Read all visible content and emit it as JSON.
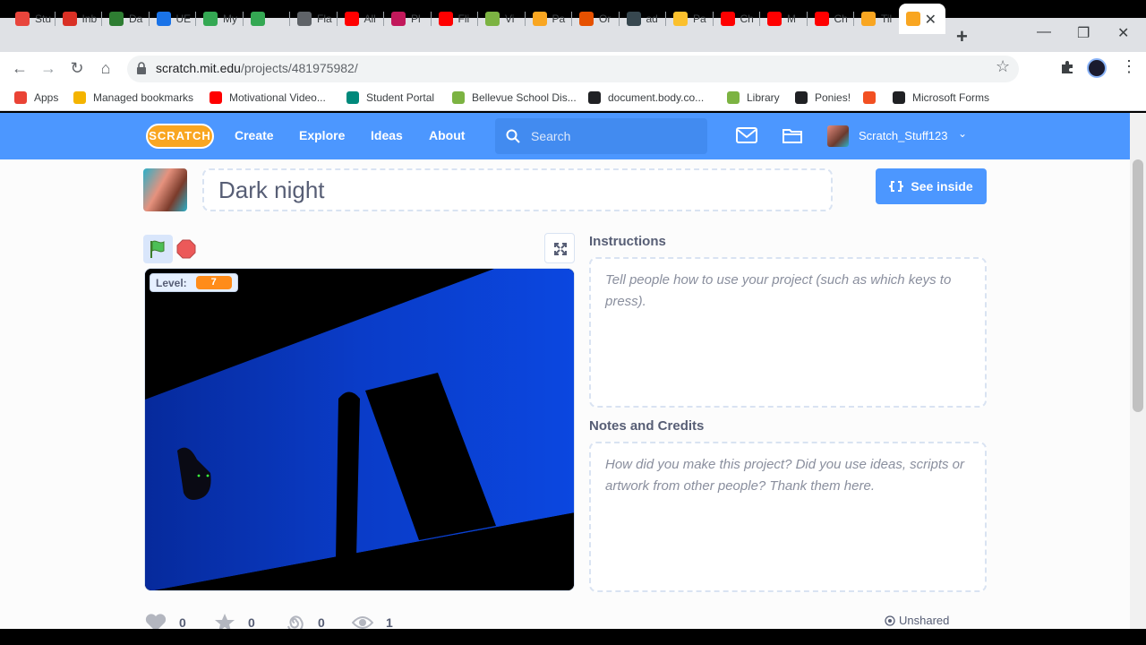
{
  "browser": {
    "tabs": [
      {
        "label": "Stu",
        "color": "#e8453c"
      },
      {
        "label": "Inb",
        "color": "#d93025"
      },
      {
        "label": "Da",
        "color": "#2e7d32"
      },
      {
        "label": "UE",
        "color": "#1a73e8"
      },
      {
        "label": "My",
        "color": "#34a853"
      },
      {
        "label": "",
        "color": "#34a853"
      },
      {
        "label": "Fla",
        "color": "#5f6368"
      },
      {
        "label": "All",
        "color": "#ff0000"
      },
      {
        "label": "Pl",
        "color": "#c2185b"
      },
      {
        "label": "Fli",
        "color": "#ff0000"
      },
      {
        "label": "Vi",
        "color": "#7cb342"
      },
      {
        "label": "Pa",
        "color": "#f9a621"
      },
      {
        "label": "Or",
        "color": "#e65100"
      },
      {
        "label": "ad",
        "color": "#37474f"
      },
      {
        "label": "Pa",
        "color": "#fbc02d"
      },
      {
        "label": "Ch",
        "color": "#ff0000"
      },
      {
        "label": "M",
        "color": "#ff0000"
      },
      {
        "label": "Ch",
        "color": "#ff0000"
      },
      {
        "label": "Til",
        "color": "#f9a621"
      }
    ],
    "active_tab_close": "✕",
    "new_tab": "+",
    "url_host": "scratch.mit.edu",
    "url_path": "/projects/481975982/",
    "bookmarks": [
      {
        "label": "Apps",
        "color": "#ea4335"
      },
      {
        "label": "Managed bookmarks",
        "color": "#f4b400"
      },
      {
        "label": "Motivational Video...",
        "color": "#ff0000"
      },
      {
        "label": "Student Portal",
        "color": "#00897b"
      },
      {
        "label": "Bellevue School Dis...",
        "color": "#7cb342"
      },
      {
        "label": "document.body.co...",
        "color": "#202124"
      },
      {
        "label": "Library",
        "color": "#7cb342"
      },
      {
        "label": "Ponies!",
        "color": "#202124"
      },
      {
        "label": "",
        "color": "#f25022"
      },
      {
        "label": "Microsoft Forms",
        "color": "#202124"
      }
    ]
  },
  "scratch": {
    "logo": "SCRATCH",
    "nav": {
      "create": "Create",
      "explore": "Explore",
      "ideas": "Ideas",
      "about": "About"
    },
    "search_placeholder": "Search",
    "username": "Scratch_Stuff123",
    "project": {
      "title": "Dark night",
      "see_inside": "See inside",
      "level_label": "Level:",
      "level_value": "7"
    },
    "instructions": {
      "heading": "Instructions",
      "placeholder": "Tell people how to use your project (such as which keys to press)."
    },
    "notes": {
      "heading": "Notes and Credits",
      "placeholder": "How did you make this project? Did you use ideas, scripts or artwork from other people? Thank them here."
    },
    "stats": {
      "loves": "0",
      "favorites": "0",
      "remixes": "0",
      "views": "1"
    },
    "share_status": "Unshared",
    "colors": {
      "scratch_blue": "#4c97ff",
      "level_orange": "#ff8c1a",
      "stage_blue": "#0a3cc8"
    }
  }
}
